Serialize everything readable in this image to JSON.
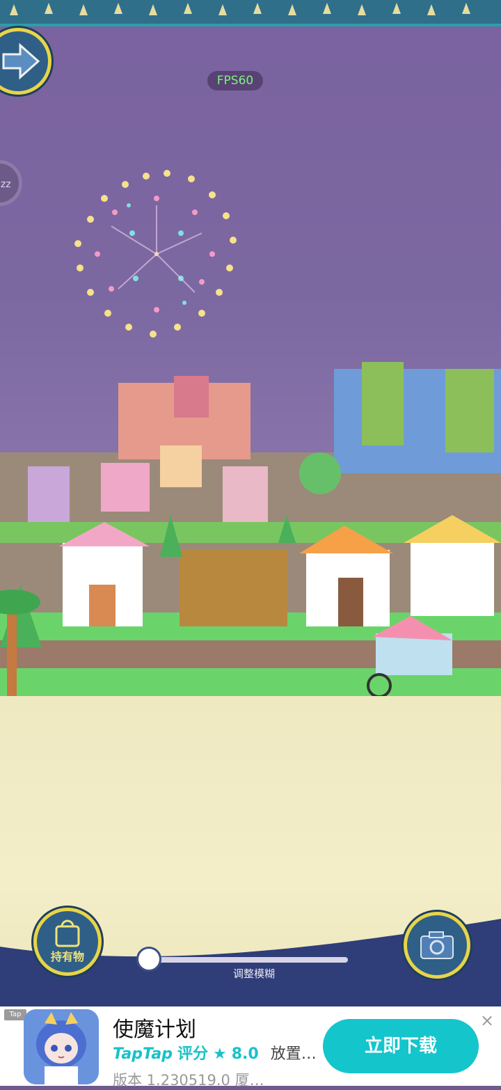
{
  "hud": {
    "fps": "FPS60",
    "slider_label": "调整模糊",
    "inventory_label": "持有物",
    "slider_value": 0.0
  },
  "icons": {
    "next": "arrow-right-icon",
    "side": "zzz-icon",
    "inventory": "bag-icon",
    "camera": "camera-icon"
  },
  "ad": {
    "tag": "Tap",
    "title": "使魔计划",
    "brand": "TapTap",
    "rating_word": "评分",
    "rating": "8.0",
    "genre": "放置…",
    "version": "版本 1.230519.0   厦…",
    "download": "立即下载",
    "close": "×"
  },
  "colors": {
    "sky": "#7a62a0",
    "ground": "#efe9c2",
    "button_ring": "#e8d44a",
    "download": "#15c5cc"
  }
}
